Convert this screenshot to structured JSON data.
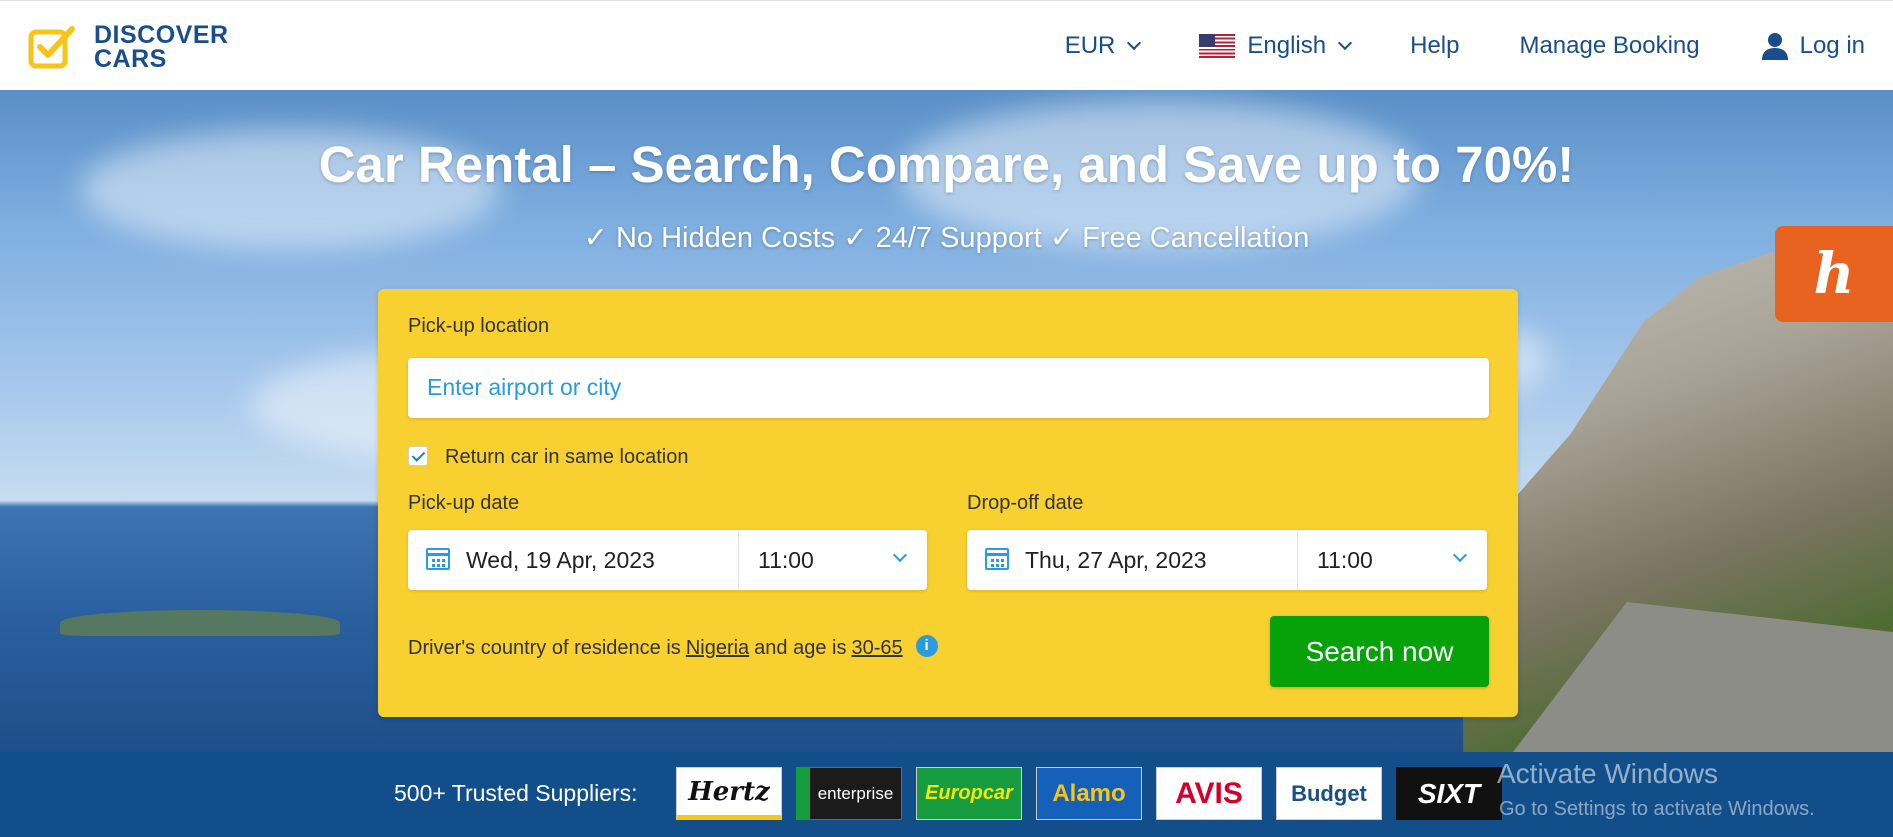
{
  "header": {
    "logo_line1": "DISCOVER",
    "logo_line2": "CARS",
    "currency": "EUR",
    "language": "English",
    "help": "Help",
    "manage_booking": "Manage Booking",
    "login": "Log in"
  },
  "hero": {
    "title": "Car Rental – Search, Compare, and Save up to 70%!",
    "subtitle": "✓ No Hidden Costs ✓ 24/7 Support ✓ Free Cancellation"
  },
  "honey": {
    "glyph": "h"
  },
  "form": {
    "pickup_location_label": "Pick-up location",
    "pickup_location_placeholder": "Enter airport or city",
    "return_same_label": "Return car in same location",
    "pickup_date_label": "Pick-up date",
    "pickup_date": "Wed, 19 Apr, 2023",
    "pickup_time": "11:00",
    "dropoff_date_label": "Drop-off date",
    "dropoff_date": "Thu, 27 Apr, 2023",
    "dropoff_time": "11:00",
    "residence_prefix": "Driver's country of residence is",
    "residence_country": "Nigeria",
    "age_prefix": "and age is",
    "age_range": "30-65",
    "search_button": "Search now"
  },
  "suppliers": {
    "label": "500+ Trusted Suppliers:",
    "brands": [
      "Hertz",
      "enterprise",
      "Europcar",
      "Alamo",
      "AVIS",
      "Budget",
      "SIXT"
    ]
  },
  "watermark": {
    "title": "Activate Windows",
    "subtitle": "Go to Settings to activate Windows."
  },
  "colors": {
    "brand_blue": "#1a4e8a",
    "form_yellow": "#f8d030",
    "search_green": "#07a20a",
    "accent_blue": "#2b9be0",
    "suppliers_bg": "#124f8a"
  }
}
